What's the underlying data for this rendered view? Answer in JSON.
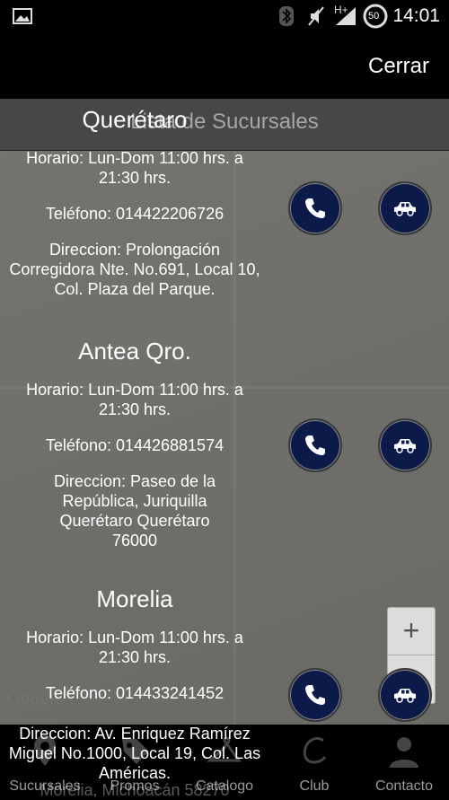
{
  "status": {
    "time": "14:01",
    "battery": "50",
    "network": "H+"
  },
  "actionbar": {
    "close_label": "Cerrar"
  },
  "list": {
    "title": "Lista de Sucursales"
  },
  "branches": [
    {
      "name": "Querétaro",
      "hours": "Horario: Lun-Dom 11:00 hrs. a 21:30 hrs.",
      "phone": "Teléfono: 014422206726",
      "address": "Direccion: Prolongación Corregidora Nte. No.691, Local 10, Col. Plaza del Parque."
    },
    {
      "name": "Antea Qro.",
      "hours": "Horario: Lun-Dom 11:00 hrs. a 21:30 hrs.",
      "phone": "Teléfono: 014426881574",
      "address": "Direccion: Paseo de la República, Juriquilla Querétaro Querétaro 76000"
    },
    {
      "name": "Morelia",
      "hours": "Horario: Lun-Dom 11:00 hrs. a 21:30 hrs.",
      "phone": "Teléfono: 014433241452",
      "address": "Direccion: Av. Enriquez Ramírez Miguel No.1000, Local 19, Col. Las Américas.",
      "address_overflow": "Morelia, Michoacán 58270"
    }
  ],
  "map": {
    "zoom_in": "+",
    "google": "Google"
  },
  "tabs": [
    {
      "label": "Sucursales",
      "icon": "map-pin-icon"
    },
    {
      "label": "Promos",
      "icon": "tag-icon"
    },
    {
      "label": "Catalogo",
      "icon": "hanger-icon"
    },
    {
      "label": "Club",
      "icon": "club-logo-icon"
    },
    {
      "label": "Contacto",
      "icon": "contact-icon"
    }
  ],
  "colors": {
    "button_bg": "#0c1a4a",
    "content_bg": "#6f6f6b"
  }
}
